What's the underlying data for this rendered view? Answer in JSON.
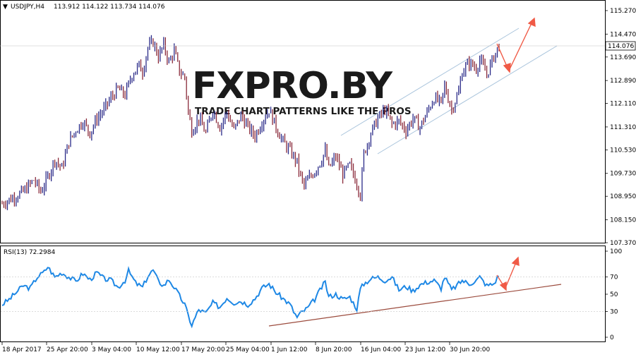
{
  "header": {
    "title": "USDJPY,H4",
    "quote": "113.912 114.122 113.734 114.076"
  },
  "rsi_header": "RSI(13) 72.2984",
  "watermark": {
    "logo": "FXPRO.BY",
    "tagline": "TRADE CHART PATTERNS LIKE THE PROS"
  },
  "current_price": "114.076",
  "colors": {
    "up_bar": "#2a2a88",
    "down_bar": "#8a2a3a",
    "rsi_line": "#1e88e5",
    "channel": "#a9c4dc",
    "support": "#9b4a3c",
    "arrow": "#f05a46"
  },
  "chart_data": [
    {
      "type": "ohlc",
      "symbol": "USDJPY",
      "timeframe": "H4",
      "ylim": [
        107.37,
        115.27
      ],
      "price_ticks": [
        "115.270",
        "114.470",
        "113.690",
        "112.890",
        "112.110",
        "111.310",
        "110.530",
        "109.730",
        "108.950",
        "108.150",
        "107.370"
      ],
      "x_labels": [
        "18 Apr 2017",
        "25 Apr 20:00",
        "3 May 04:00",
        "10 May 12:00",
        "17 May 20:00",
        "25 May 04:00",
        "1 Jun 12:00",
        "8 Jun 20:00",
        "16 Jun 04:00",
        "23 Jun 12:00",
        "30 Jun 20:00"
      ],
      "close_path": [
        [
          0,
          108.7
        ],
        [
          6,
          108.9
        ],
        [
          12,
          109.1
        ],
        [
          18,
          109.5
        ],
        [
          22,
          109.1
        ],
        [
          26,
          109.6
        ],
        [
          30,
          110.2
        ],
        [
          34,
          109.9
        ],
        [
          38,
          110.8
        ],
        [
          42,
          111.2
        ],
        [
          46,
          111.5
        ],
        [
          50,
          111.1
        ],
        [
          54,
          111.6
        ],
        [
          58,
          111.9
        ],
        [
          62,
          112.3
        ],
        [
          66,
          112.6
        ],
        [
          70,
          112.4
        ],
        [
          74,
          113.1
        ],
        [
          78,
          113.4
        ],
        [
          80,
          113.2
        ],
        [
          83,
          114.0
        ],
        [
          86,
          114.2
        ],
        [
          89,
          113.7
        ],
        [
          92,
          114.1
        ],
        [
          95,
          113.5
        ],
        [
          98,
          113.9
        ],
        [
          101,
          113.2
        ],
        [
          104,
          113.0
        ],
        [
          106,
          111.8
        ],
        [
          108,
          111.2
        ],
        [
          112,
          111.6
        ],
        [
          116,
          111.1
        ],
        [
          120,
          111.9
        ],
        [
          124,
          111.3
        ],
        [
          128,
          111.8
        ],
        [
          132,
          111.2
        ],
        [
          136,
          111.7
        ],
        [
          140,
          111.3
        ],
        [
          144,
          111.0
        ],
        [
          148,
          111.5
        ],
        [
          152,
          111.9
        ],
        [
          156,
          111.3
        ],
        [
          160,
          110.8
        ],
        [
          164,
          110.5
        ],
        [
          168,
          110.1
        ],
        [
          170,
          109.6
        ],
        [
          172,
          109.3
        ],
        [
          174,
          109.5
        ],
        [
          178,
          109.8
        ],
        [
          182,
          110.2
        ],
        [
          184,
          110.5
        ],
        [
          186,
          109.9
        ],
        [
          190,
          110.3
        ],
        [
          194,
          109.7
        ],
        [
          198,
          110.0
        ],
        [
          202,
          109.4
        ],
        [
          204,
          109.0
        ],
        [
          206,
          110.4
        ],
        [
          210,
          111.1
        ],
        [
          214,
          111.6
        ],
        [
          218,
          111.9
        ],
        [
          222,
          111.4
        ],
        [
          226,
          111.5
        ],
        [
          230,
          111.2
        ],
        [
          234,
          111.6
        ],
        [
          238,
          111.3
        ],
        [
          242,
          111.8
        ],
        [
          246,
          112.3
        ],
        [
          250,
          112.1
        ],
        [
          252,
          112.7
        ],
        [
          256,
          111.9
        ],
        [
          260,
          112.5
        ],
        [
          262,
          113.2
        ],
        [
          266,
          113.5
        ],
        [
          270,
          113.3
        ],
        [
          272,
          113.6
        ],
        [
          276,
          113.1
        ],
        [
          280,
          113.7
        ],
        [
          283,
          114.08
        ]
      ]
    },
    {
      "type": "line",
      "name": "RSI(13)",
      "ylim": [
        0,
        100
      ],
      "y_ticks": [
        "100",
        "70",
        "50",
        "30",
        "0"
      ],
      "levels": [
        70,
        30
      ],
      "values": [
        [
          0,
          38
        ],
        [
          4,
          44
        ],
        [
          8,
          52
        ],
        [
          12,
          60
        ],
        [
          16,
          57
        ],
        [
          20,
          70
        ],
        [
          24,
          76
        ],
        [
          26,
          82
        ],
        [
          30,
          70
        ],
        [
          34,
          75
        ],
        [
          38,
          70
        ],
        [
          42,
          65
        ],
        [
          46,
          74
        ],
        [
          50,
          67
        ],
        [
          54,
          75
        ],
        [
          58,
          68
        ],
        [
          62,
          66
        ],
        [
          66,
          58
        ],
        [
          70,
          66
        ],
        [
          72,
          77
        ],
        [
          76,
          63
        ],
        [
          80,
          58
        ],
        [
          83,
          71
        ],
        [
          86,
          78
        ],
        [
          89,
          65
        ],
        [
          92,
          60
        ],
        [
          95,
          67
        ],
        [
          98,
          58
        ],
        [
          101,
          48
        ],
        [
          104,
          38
        ],
        [
          106,
          25
        ],
        [
          108,
          14
        ],
        [
          112,
          32
        ],
        [
          116,
          28
        ],
        [
          120,
          40
        ],
        [
          124,
          35
        ],
        [
          128,
          46
        ],
        [
          132,
          40
        ],
        [
          136,
          42
        ],
        [
          140,
          38
        ],
        [
          144,
          45
        ],
        [
          148,
          57
        ],
        [
          152,
          62
        ],
        [
          156,
          52
        ],
        [
          160,
          45
        ],
        [
          164,
          38
        ],
        [
          166,
          30
        ],
        [
          168,
          23
        ],
        [
          170,
          28
        ],
        [
          174,
          34
        ],
        [
          178,
          44
        ],
        [
          182,
          58
        ],
        [
          184,
          64
        ],
        [
          186,
          47
        ],
        [
          190,
          50
        ],
        [
          194,
          44
        ],
        [
          198,
          47
        ],
        [
          200,
          40
        ],
        [
          202,
          33
        ],
        [
          204,
          56
        ],
        [
          206,
          62
        ],
        [
          210,
          68
        ],
        [
          214,
          70
        ],
        [
          218,
          66
        ],
        [
          222,
          70
        ],
        [
          226,
          55
        ],
        [
          230,
          59
        ],
        [
          234,
          54
        ],
        [
          238,
          61
        ],
        [
          242,
          64
        ],
        [
          246,
          66
        ],
        [
          250,
          57
        ],
        [
          252,
          70
        ],
        [
          256,
          55
        ],
        [
          260,
          62
        ],
        [
          262,
          66
        ],
        [
          266,
          62
        ],
        [
          270,
          66
        ],
        [
          272,
          70
        ],
        [
          276,
          60
        ],
        [
          280,
          62
        ],
        [
          283,
          72.3
        ]
      ]
    }
  ]
}
